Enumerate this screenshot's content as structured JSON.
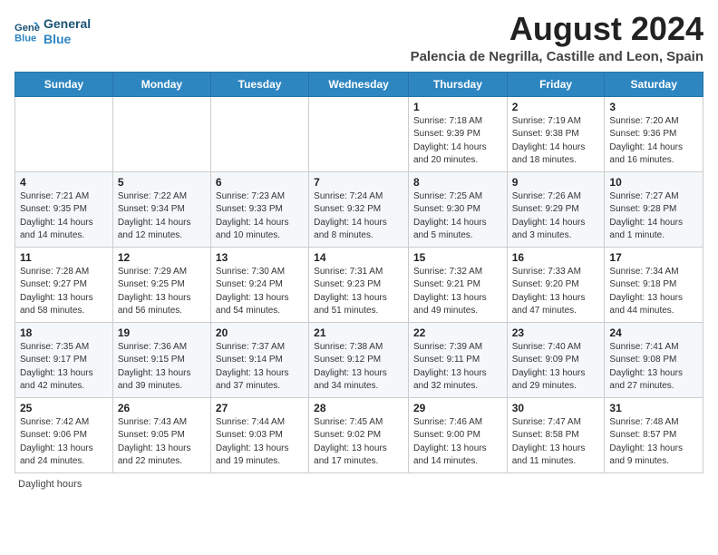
{
  "header": {
    "logo_line1": "General",
    "logo_line2": "Blue",
    "month_title": "August 2024",
    "subtitle": "Palencia de Negrilla, Castille and Leon, Spain"
  },
  "days_of_week": [
    "Sunday",
    "Monday",
    "Tuesday",
    "Wednesday",
    "Thursday",
    "Friday",
    "Saturday"
  ],
  "weeks": [
    [
      {
        "day": "",
        "info": ""
      },
      {
        "day": "",
        "info": ""
      },
      {
        "day": "",
        "info": ""
      },
      {
        "day": "",
        "info": ""
      },
      {
        "day": "1",
        "info": "Sunrise: 7:18 AM\nSunset: 9:39 PM\nDaylight: 14 hours\nand 20 minutes."
      },
      {
        "day": "2",
        "info": "Sunrise: 7:19 AM\nSunset: 9:38 PM\nDaylight: 14 hours\nand 18 minutes."
      },
      {
        "day": "3",
        "info": "Sunrise: 7:20 AM\nSunset: 9:36 PM\nDaylight: 14 hours\nand 16 minutes."
      }
    ],
    [
      {
        "day": "4",
        "info": "Sunrise: 7:21 AM\nSunset: 9:35 PM\nDaylight: 14 hours\nand 14 minutes."
      },
      {
        "day": "5",
        "info": "Sunrise: 7:22 AM\nSunset: 9:34 PM\nDaylight: 14 hours\nand 12 minutes."
      },
      {
        "day": "6",
        "info": "Sunrise: 7:23 AM\nSunset: 9:33 PM\nDaylight: 14 hours\nand 10 minutes."
      },
      {
        "day": "7",
        "info": "Sunrise: 7:24 AM\nSunset: 9:32 PM\nDaylight: 14 hours\nand 8 minutes."
      },
      {
        "day": "8",
        "info": "Sunrise: 7:25 AM\nSunset: 9:30 PM\nDaylight: 14 hours\nand 5 minutes."
      },
      {
        "day": "9",
        "info": "Sunrise: 7:26 AM\nSunset: 9:29 PM\nDaylight: 14 hours\nand 3 minutes."
      },
      {
        "day": "10",
        "info": "Sunrise: 7:27 AM\nSunset: 9:28 PM\nDaylight: 14 hours\nand 1 minute."
      }
    ],
    [
      {
        "day": "11",
        "info": "Sunrise: 7:28 AM\nSunset: 9:27 PM\nDaylight: 13 hours\nand 58 minutes."
      },
      {
        "day": "12",
        "info": "Sunrise: 7:29 AM\nSunset: 9:25 PM\nDaylight: 13 hours\nand 56 minutes."
      },
      {
        "day": "13",
        "info": "Sunrise: 7:30 AM\nSunset: 9:24 PM\nDaylight: 13 hours\nand 54 minutes."
      },
      {
        "day": "14",
        "info": "Sunrise: 7:31 AM\nSunset: 9:23 PM\nDaylight: 13 hours\nand 51 minutes."
      },
      {
        "day": "15",
        "info": "Sunrise: 7:32 AM\nSunset: 9:21 PM\nDaylight: 13 hours\nand 49 minutes."
      },
      {
        "day": "16",
        "info": "Sunrise: 7:33 AM\nSunset: 9:20 PM\nDaylight: 13 hours\nand 47 minutes."
      },
      {
        "day": "17",
        "info": "Sunrise: 7:34 AM\nSunset: 9:18 PM\nDaylight: 13 hours\nand 44 minutes."
      }
    ],
    [
      {
        "day": "18",
        "info": "Sunrise: 7:35 AM\nSunset: 9:17 PM\nDaylight: 13 hours\nand 42 minutes."
      },
      {
        "day": "19",
        "info": "Sunrise: 7:36 AM\nSunset: 9:15 PM\nDaylight: 13 hours\nand 39 minutes."
      },
      {
        "day": "20",
        "info": "Sunrise: 7:37 AM\nSunset: 9:14 PM\nDaylight: 13 hours\nand 37 minutes."
      },
      {
        "day": "21",
        "info": "Sunrise: 7:38 AM\nSunset: 9:12 PM\nDaylight: 13 hours\nand 34 minutes."
      },
      {
        "day": "22",
        "info": "Sunrise: 7:39 AM\nSunset: 9:11 PM\nDaylight: 13 hours\nand 32 minutes."
      },
      {
        "day": "23",
        "info": "Sunrise: 7:40 AM\nSunset: 9:09 PM\nDaylight: 13 hours\nand 29 minutes."
      },
      {
        "day": "24",
        "info": "Sunrise: 7:41 AM\nSunset: 9:08 PM\nDaylight: 13 hours\nand 27 minutes."
      }
    ],
    [
      {
        "day": "25",
        "info": "Sunrise: 7:42 AM\nSunset: 9:06 PM\nDaylight: 13 hours\nand 24 minutes."
      },
      {
        "day": "26",
        "info": "Sunrise: 7:43 AM\nSunset: 9:05 PM\nDaylight: 13 hours\nand 22 minutes."
      },
      {
        "day": "27",
        "info": "Sunrise: 7:44 AM\nSunset: 9:03 PM\nDaylight: 13 hours\nand 19 minutes."
      },
      {
        "day": "28",
        "info": "Sunrise: 7:45 AM\nSunset: 9:02 PM\nDaylight: 13 hours\nand 17 minutes."
      },
      {
        "day": "29",
        "info": "Sunrise: 7:46 AM\nSunset: 9:00 PM\nDaylight: 13 hours\nand 14 minutes."
      },
      {
        "day": "30",
        "info": "Sunrise: 7:47 AM\nSunset: 8:58 PM\nDaylight: 13 hours\nand 11 minutes."
      },
      {
        "day": "31",
        "info": "Sunrise: 7:48 AM\nSunset: 8:57 PM\nDaylight: 13 hours\nand 9 minutes."
      }
    ]
  ],
  "footer": "Daylight hours"
}
